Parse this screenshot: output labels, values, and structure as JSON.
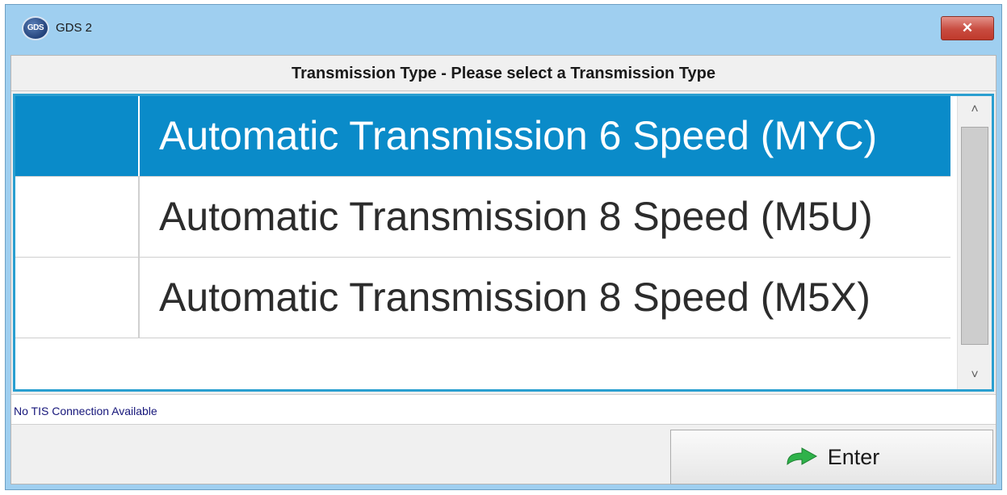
{
  "window": {
    "app_logo_text": "GDS",
    "title": "GDS 2",
    "close_label": "✕"
  },
  "header": {
    "title": "Transmission Type - Please select a Transmission Type"
  },
  "list": {
    "items": [
      {
        "label": "Automatic Transmission 6 Speed (MYC)",
        "selected": true
      },
      {
        "label": "Automatic Transmission 8 Speed (M5U)",
        "selected": false
      },
      {
        "label": "Automatic Transmission 8 Speed (M5X)",
        "selected": false
      }
    ],
    "scroll_up_label": "˄",
    "scroll_down_label": "˅"
  },
  "status": {
    "text": "No TIS Connection Available"
  },
  "footer": {
    "enter_label": "Enter",
    "enter_icon": "green-arrow-icon"
  },
  "colors": {
    "selection": "#0a8bc9",
    "window_frame": "#9fcff0",
    "list_border": "#2a9fd0",
    "close_button": "#c84c40",
    "enter_arrow": "#2fb24a"
  }
}
